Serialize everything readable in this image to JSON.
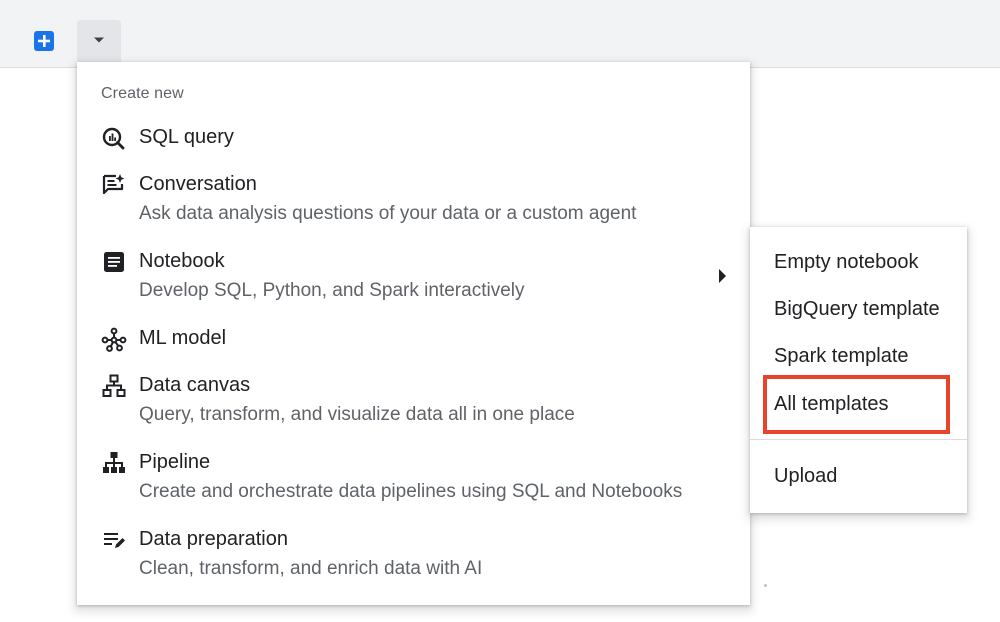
{
  "colors": {
    "accent": "#1a73e8",
    "highlight": "#e8432b",
    "topbar": "#f1f3f4"
  },
  "toolbar": {
    "add_icon": "plus-square-icon",
    "dropdown_icon": "caret-down-icon"
  },
  "menu": {
    "header": "Create new",
    "items": [
      {
        "icon": "sql-query-icon",
        "title": "SQL query",
        "desc": ""
      },
      {
        "icon": "conversation-icon",
        "title": "Conversation",
        "desc": "Ask data analysis questions of your data or a custom agent"
      },
      {
        "icon": "notebook-icon",
        "title": "Notebook",
        "desc": "Develop SQL, Python, and Spark interactively",
        "has_submenu": true
      },
      {
        "icon": "ml-model-icon",
        "title": "ML model",
        "desc": ""
      },
      {
        "icon": "data-canvas-icon",
        "title": "Data canvas",
        "desc": "Query, transform, and visualize data all in one place"
      },
      {
        "icon": "pipeline-icon",
        "title": "Pipeline",
        "desc": "Create and orchestrate data pipelines using SQL and Notebooks"
      },
      {
        "icon": "data-preparation-icon",
        "title": "Data preparation",
        "desc": "Clean, transform, and enrich data with AI"
      }
    ]
  },
  "submenu": {
    "items": [
      "Empty notebook",
      "BigQuery template",
      "Spark template",
      "All templates",
      "Upload"
    ],
    "highlighted": "All templates"
  }
}
